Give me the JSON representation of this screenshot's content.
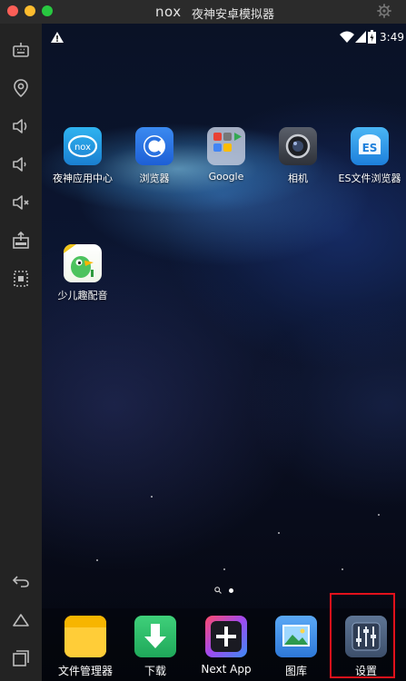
{
  "window": {
    "logo_text": "nox",
    "title": "夜神安卓模拟器"
  },
  "status_bar": {
    "time": "3:49"
  },
  "home_apps": [
    {
      "label": "夜神应用中心"
    },
    {
      "label": "浏览器"
    },
    {
      "label": "Google"
    },
    {
      "label": "相机"
    },
    {
      "label": "ES文件浏览器"
    },
    {
      "label": "少儿趣配音"
    }
  ],
  "dock_apps": [
    {
      "label": "文件管理器"
    },
    {
      "label": "下载"
    },
    {
      "label": "Next App"
    },
    {
      "label": "图库"
    },
    {
      "label": "设置"
    }
  ],
  "colors": {
    "highlight": "#e2111b",
    "nox_blue": "#1e9be0"
  }
}
